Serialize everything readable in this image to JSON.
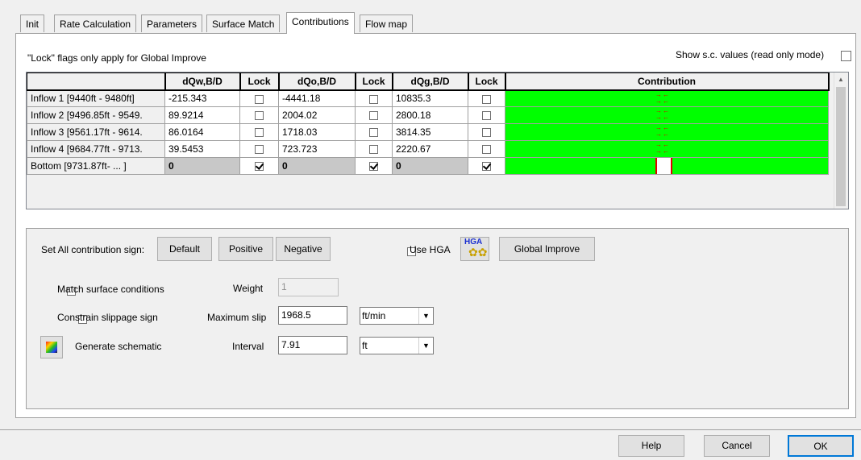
{
  "tabs": [
    "Init",
    "Rate Calculation",
    "Parameters",
    "Surface Match",
    "Contributions",
    "Flow map"
  ],
  "active_tab": "Contributions",
  "lock_note": "\"Lock\" flags only apply for Global Improve",
  "show_sc_label": "Show s.c. values (read only mode)",
  "columns": [
    "dQw,B/D",
    "Lock",
    "dQo,B/D",
    "Lock",
    "dQg,B/D",
    "Lock",
    "Contribution"
  ],
  "rows": [
    {
      "name": "Inflow 1  [9440ft - 9480ft]",
      "dqw": "-215.343",
      "dqo": "-4441.18",
      "dqg": "10835.3",
      "locked": false
    },
    {
      "name": "Inflow 2  [9496.85ft - 9549.",
      "dqw": "89.9214",
      "dqo": "2004.02",
      "dqg": "2800.18",
      "locked": false
    },
    {
      "name": "Inflow 3  [9561.17ft - 9614.",
      "dqw": "86.0164",
      "dqo": "1718.03",
      "dqg": "3814.35",
      "locked": false
    },
    {
      "name": "Inflow 4  [9684.77ft - 9713.",
      "dqw": "39.5453",
      "dqo": "723.723",
      "dqg": "2220.67",
      "locked": false
    },
    {
      "name": "Bottom   [9731.87ft- ... ]",
      "dqw": "0",
      "dqo": "0",
      "dqg": "0",
      "locked": true
    }
  ],
  "sign_label": "Set All contribution sign:",
  "sign_buttons": {
    "default": "Default",
    "positive": "Positive",
    "negative": "Negative"
  },
  "use_hga_label": "Use HGA",
  "hga_icon_text": "HGA",
  "global_improve": "Global Improve",
  "match_surface_label": "Match surface conditions",
  "weight_label": "Weight",
  "weight_value": "1",
  "constrain_label": "Constrain slippage sign",
  "max_slip_label": "Maximum slip",
  "max_slip_value": "1968.5",
  "max_slip_unit": "ft/min",
  "generate_label": "Generate schematic",
  "interval_label": "Interval",
  "interval_value": "7.91",
  "interval_unit": "ft",
  "footer": {
    "help": "Help",
    "cancel": "Cancel",
    "ok": "OK"
  },
  "colors": {
    "contribution_bg": "#00ff00",
    "arrow": "#e00000",
    "tab_active": "#ffffff"
  }
}
